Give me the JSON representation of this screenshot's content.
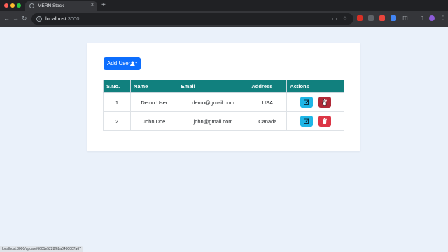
{
  "browser": {
    "tab_title": "MERN Stack",
    "tab_close": "×",
    "new_tab": "+",
    "url_host": "localhost",
    "url_port": ":3000",
    "status_url": "localhost:3000/update/6601e5228f62a0460007a67"
  },
  "toolbar": {
    "back": "←",
    "forward": "→",
    "reload": "↻"
  },
  "main": {
    "add_button_label": "Add User",
    "table": {
      "headers": [
        "S.No.",
        "Name",
        "Email",
        "Address",
        "Actions"
      ],
      "rows": [
        {
          "sno": "1",
          "name": "Demo User",
          "email": "demo@gmail.com",
          "address": "USA"
        },
        {
          "sno": "2",
          "name": "John Doe",
          "email": "john@gmail.com",
          "address": "Canada"
        }
      ]
    }
  },
  "colors": {
    "header_bg": "#11807e",
    "primary": "#0d6efd",
    "info": "#1fb6e6",
    "danger": "#dc3545"
  },
  "icons": [
    "info-icon",
    "user-plus-icon",
    "edit-icon",
    "trash-icon",
    "star-icon",
    "extensions-icon"
  ]
}
